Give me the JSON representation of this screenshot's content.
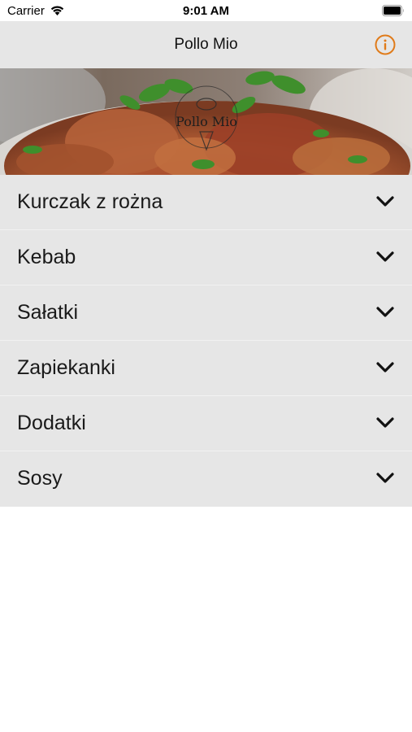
{
  "status_bar": {
    "carrier": "Carrier",
    "time": "9:01 AM"
  },
  "nav": {
    "title": "Pollo Mio",
    "info_icon": "info-icon",
    "accent_color": "#e07b1a"
  },
  "banner": {
    "logo_text": "Pollo Mio"
  },
  "menu": {
    "items": [
      {
        "label": "Kurczak z rożna",
        "icon": "chevron-down-icon"
      },
      {
        "label": "Kebab",
        "icon": "chevron-down-icon"
      },
      {
        "label": "Sałatki",
        "icon": "chevron-down-icon"
      },
      {
        "label": "Zapiekanki",
        "icon": "chevron-down-icon"
      },
      {
        "label": "Dodatki",
        "icon": "chevron-down-icon"
      },
      {
        "label": "Sosy",
        "icon": "chevron-down-icon"
      }
    ]
  }
}
